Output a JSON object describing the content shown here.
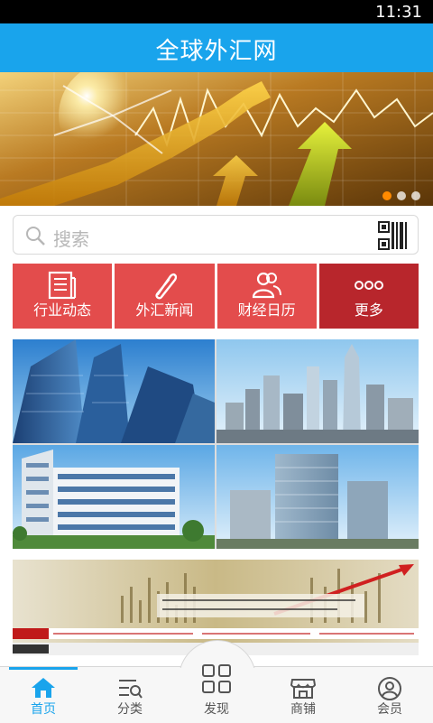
{
  "status": {
    "time": "11:31"
  },
  "header": {
    "title": "全球外汇网"
  },
  "banner": {
    "slides": 3,
    "active_slide": 1
  },
  "search": {
    "placeholder": "搜索"
  },
  "categories": [
    {
      "label": "行业动态",
      "icon": "newspaper-icon"
    },
    {
      "label": "外汇新闻",
      "icon": "paperclip-icon"
    },
    {
      "label": "财经日历",
      "icon": "people-icon"
    },
    {
      "label": "更多",
      "icon": "more-dots-icon"
    }
  ],
  "tiles": [
    {
      "name": "skyscraper-glass-tile"
    },
    {
      "name": "city-skyline-tile"
    },
    {
      "name": "office-building-tile"
    },
    {
      "name": "modern-towers-tile"
    }
  ],
  "bottom_nav": [
    {
      "label": "首页",
      "icon": "home-icon",
      "active": true
    },
    {
      "label": "分类",
      "icon": "category-icon",
      "active": false
    },
    {
      "label": "发现",
      "icon": "grid-icon",
      "active": false
    },
    {
      "label": "商铺",
      "icon": "shop-icon",
      "active": false
    },
    {
      "label": "会员",
      "icon": "user-icon",
      "active": false
    }
  ],
  "colors": {
    "primary": "#19a4ec",
    "category_red": "#e34c4c",
    "category_dark_red": "#b8262c"
  }
}
